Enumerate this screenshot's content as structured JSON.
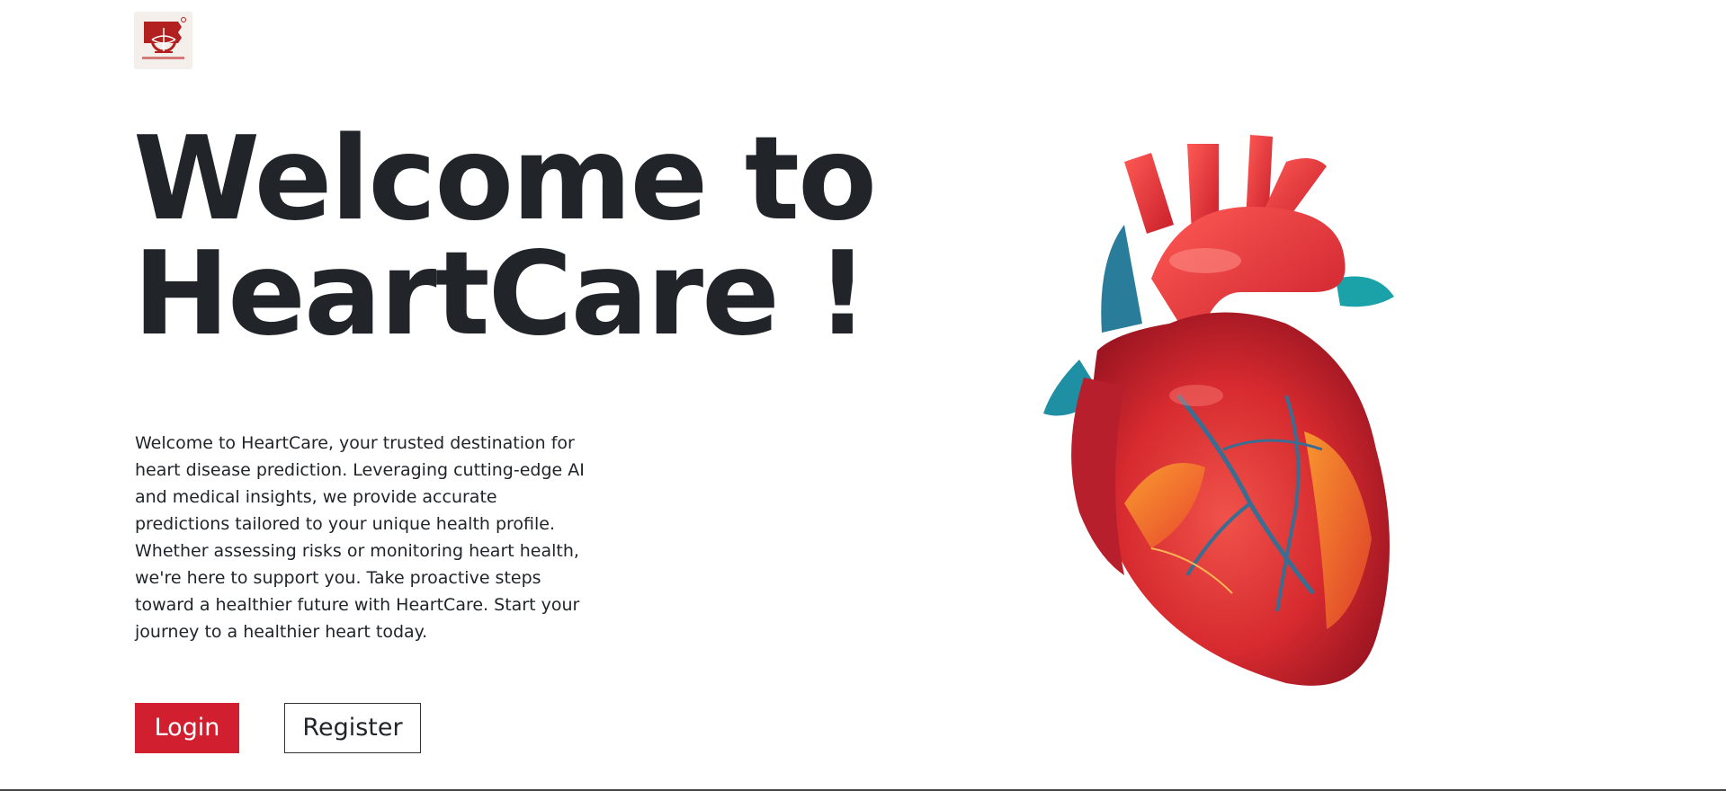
{
  "logo": {
    "icon": "globe-flag-logo",
    "brand_color": "#b32020"
  },
  "hero": {
    "title_line1": "Welcome to",
    "title_line2": "HeartCare !",
    "description": "Welcome to HeartCare, your trusted destination for heart disease prediction. Leveraging cutting-edge AI and medical insights, we provide accurate predictions tailored to your unique health profile. Whether assessing risks or monitoring heart health, we're here to support you. Take proactive steps toward a healthier future with HeartCare. Start your journey to a healthier heart today."
  },
  "actions": {
    "login_label": "Login",
    "register_label": "Register"
  },
  "illustration": {
    "icon": "anatomical-heart-illustration"
  },
  "colors": {
    "accent": "#d11f2f",
    "text": "#212529",
    "background": "#ffffff"
  }
}
